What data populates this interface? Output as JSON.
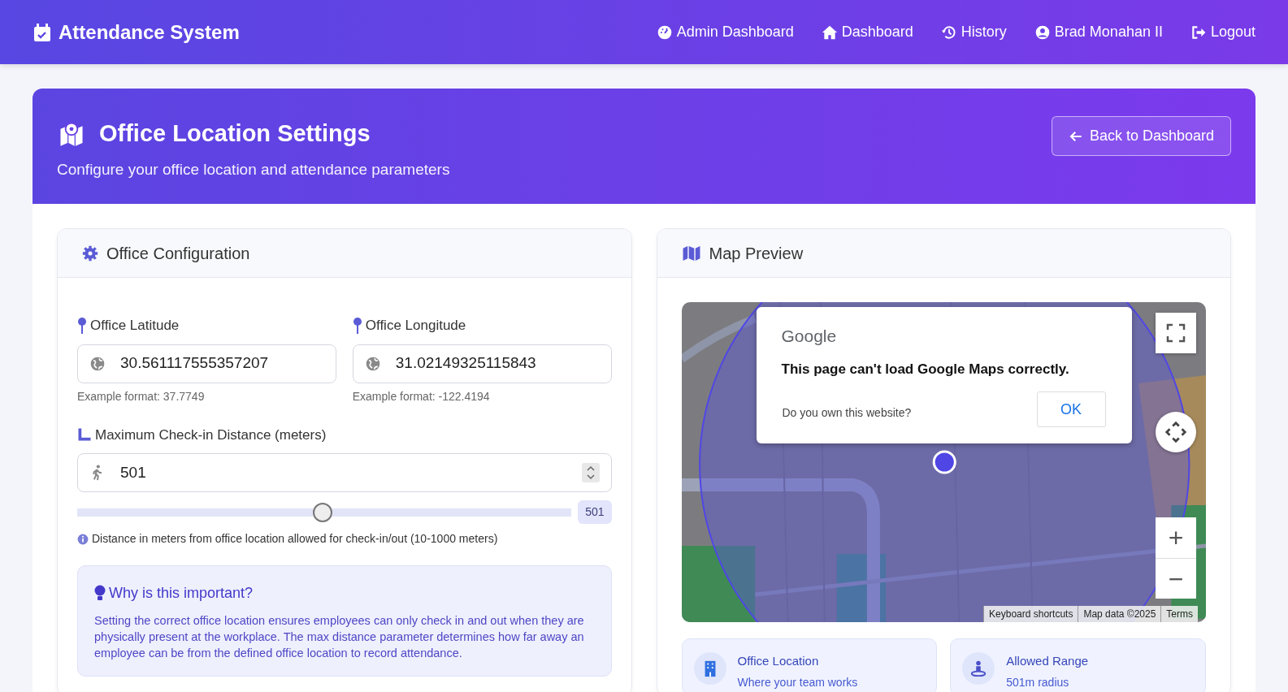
{
  "navbar": {
    "brand": "Attendance System",
    "links": [
      {
        "kind": "admin",
        "label": "Admin Dashboard"
      },
      {
        "kind": "home",
        "label": "Dashboard"
      },
      {
        "kind": "history",
        "label": "History"
      },
      {
        "kind": "user",
        "label": "Brad Monahan II"
      },
      {
        "kind": "logout",
        "label": "Logout"
      }
    ]
  },
  "header": {
    "title": "Office Location Settings",
    "subtitle": "Configure your office location and attendance parameters",
    "back_button": "Back to Dashboard"
  },
  "config": {
    "title": "Office Configuration",
    "fields": [
      {
        "label": "Office Latitude",
        "value": "30.561117555357207",
        "help": "Example format: 37.7749"
      },
      {
        "label": "Office Longitude",
        "value": "31.02149325115843",
        "help": "Example format: -122.4194"
      }
    ],
    "distance": {
      "label": "Maximum Check-in Distance (meters)",
      "value": "501",
      "level": 0.496,
      "badge": "501",
      "help": "Distance in meters from office location allowed for check-in/out (10-1000 meters)"
    },
    "note": {
      "title": "Why is this important?",
      "text": "Setting the correct office location ensures employees can only check in and out when they are physically present at the workplace. The max distance parameter determines how far away an employee can be from the defined office location to record attendance."
    }
  },
  "map": {
    "title": "Map Preview",
    "dialog": {
      "logo": "Google",
      "message": "This page can't load Google Maps correctly.",
      "question": "Do you own this website?",
      "button": "OK"
    },
    "zoom_in": "+",
    "zoom_out": "−",
    "attribution": [
      "Keyboard shortcuts",
      "Map data ©2025",
      "Terms"
    ],
    "info_cards": [
      {
        "kind": "building",
        "title": "Office Location",
        "subtitle": "Where your team works"
      },
      {
        "kind": "range",
        "title": "Allowed Range",
        "subtitle": "501m radius"
      }
    ]
  }
}
